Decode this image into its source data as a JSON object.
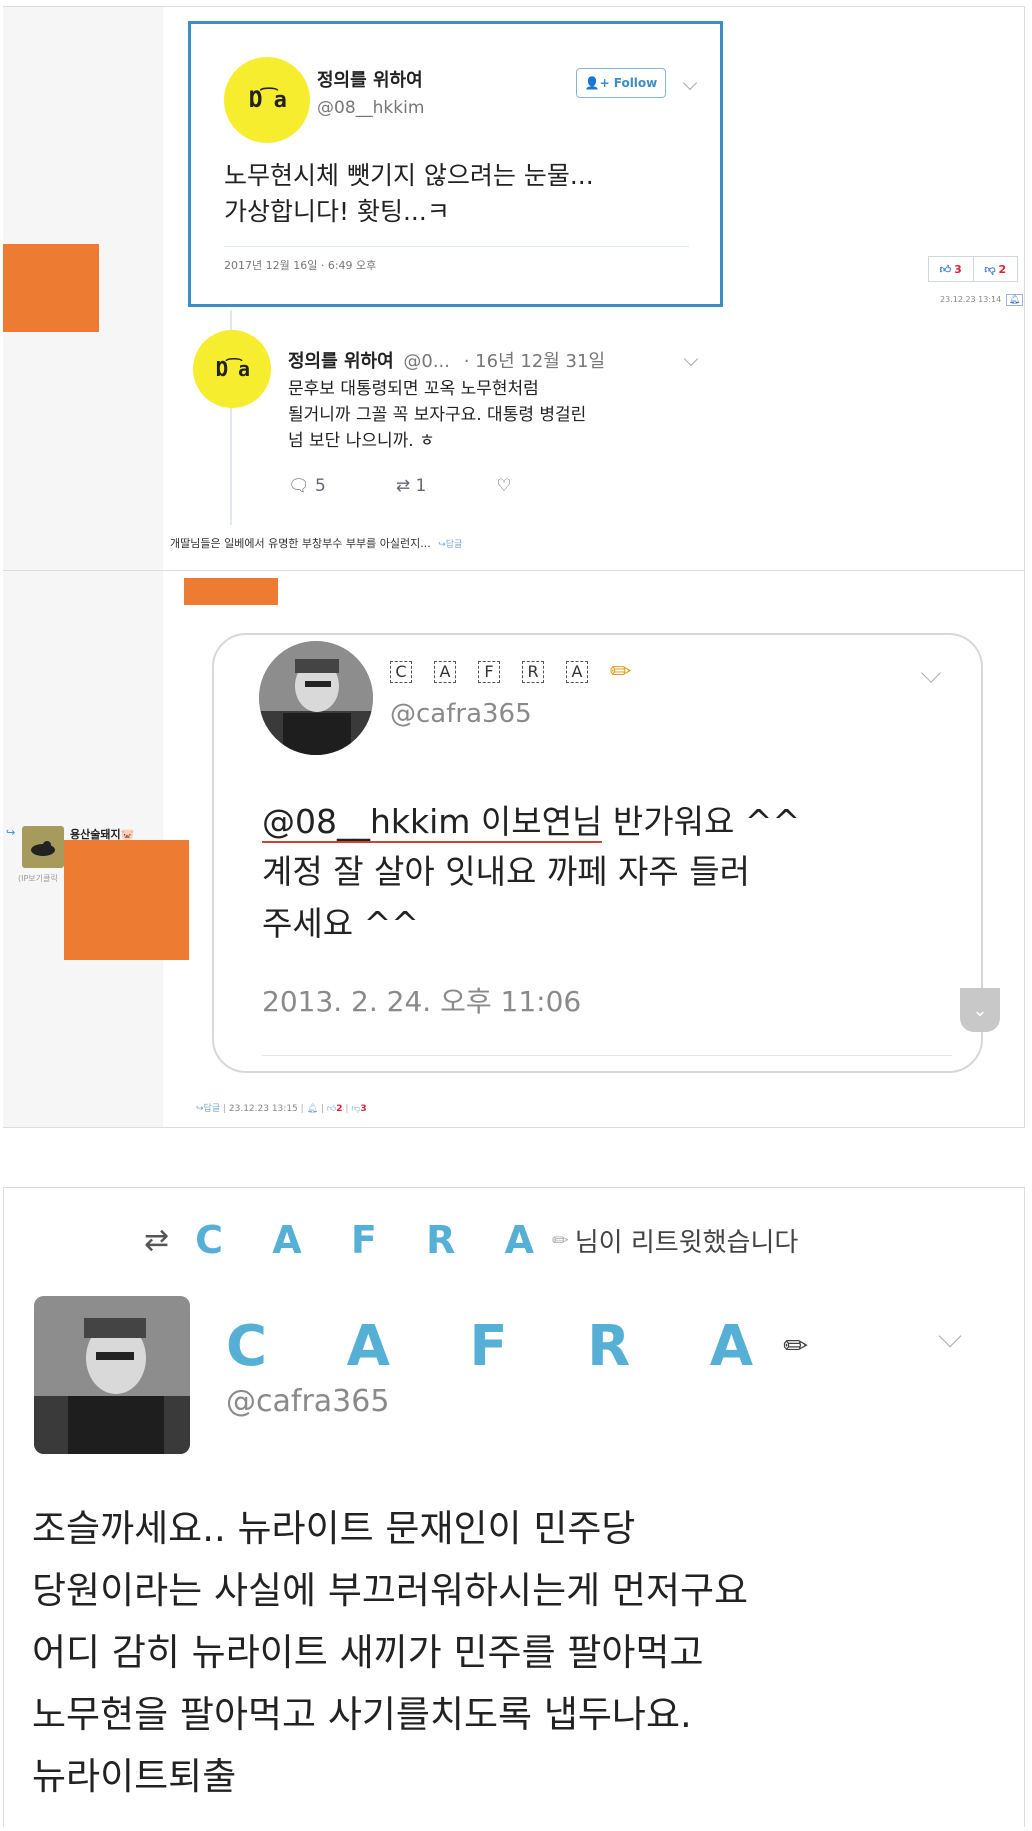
{
  "tweet1": {
    "name": "정의를 위하여",
    "handle": "@08__hkkim",
    "follow_label": "Follow",
    "text_line1": "노무현시체 뺏기지 않으려는 눈물...",
    "text_line2": "가상합니다! 홧팅...ㅋ",
    "date": "2017년 12월 16일 · 6:49 오후"
  },
  "tweet2": {
    "name": "정의를 위하여",
    "handle_trunc": "@0...",
    "date": "· 16년 12월 31일",
    "line1": "문후보 대통령되면 꼬옥 노무현처럼",
    "line2": "될거니까 그꼴 꼭 보자구요. 대통령 병걸린",
    "line3": "넘 보단 나으니까. ㅎ",
    "replies": "5",
    "retweets": "1"
  },
  "comment1": {
    "text": "개딸님들은 일베에서 유명한 부창부수 부부를 아실런지...",
    "reply_link": "↪답글",
    "upvotes": "3",
    "downvotes": "2",
    "timestamp": "23.12.23 13:14"
  },
  "user2": {
    "name": "용산술돼지🐷",
    "ip_label": "(IP보기클릭"
  },
  "tweet3": {
    "letters": [
      "C",
      "A",
      "F",
      "R",
      "A"
    ],
    "handle": "@cafra365",
    "mention": "@08__hkkim 이보연님",
    "line1_rest": " 반가워요 ^^",
    "line2": "계정 잘 살아 잇내요 까페 자주 들러",
    "line3": "주세요 ^^",
    "date": "2013. 2. 24. 오후 11:06"
  },
  "comment2": {
    "reply_link": "↪답글",
    "timestamp": "23.12.23 13:15",
    "upvotes": "2",
    "downvotes": "3"
  },
  "tweet4": {
    "retweet_name": "C A F R A",
    "retweet_suffix": "님이 리트윗했습니다",
    "name": "C A F R A",
    "handle": "@cafra365",
    "line1": "조슬까세요.. 뉴라이트 문재인이 민주당",
    "line2": "당원이라는 사실에 부끄러워하시는게 먼저구요",
    "line3": "어디 감히 뉴라이트 새끼가 민주를 팔아먹고",
    "line4": "노무현을 팔아먹고 사기를치도록 냅두나요.",
    "line5": "뉴라이트퇴출"
  },
  "colors": {
    "accent_blue": "#3b8fc4",
    "redaction_orange": "#ee7b32",
    "avatar_yellow": "#f5ed2e",
    "cafra_blue": "#56b0d6",
    "vote_red": "#dd2233"
  }
}
